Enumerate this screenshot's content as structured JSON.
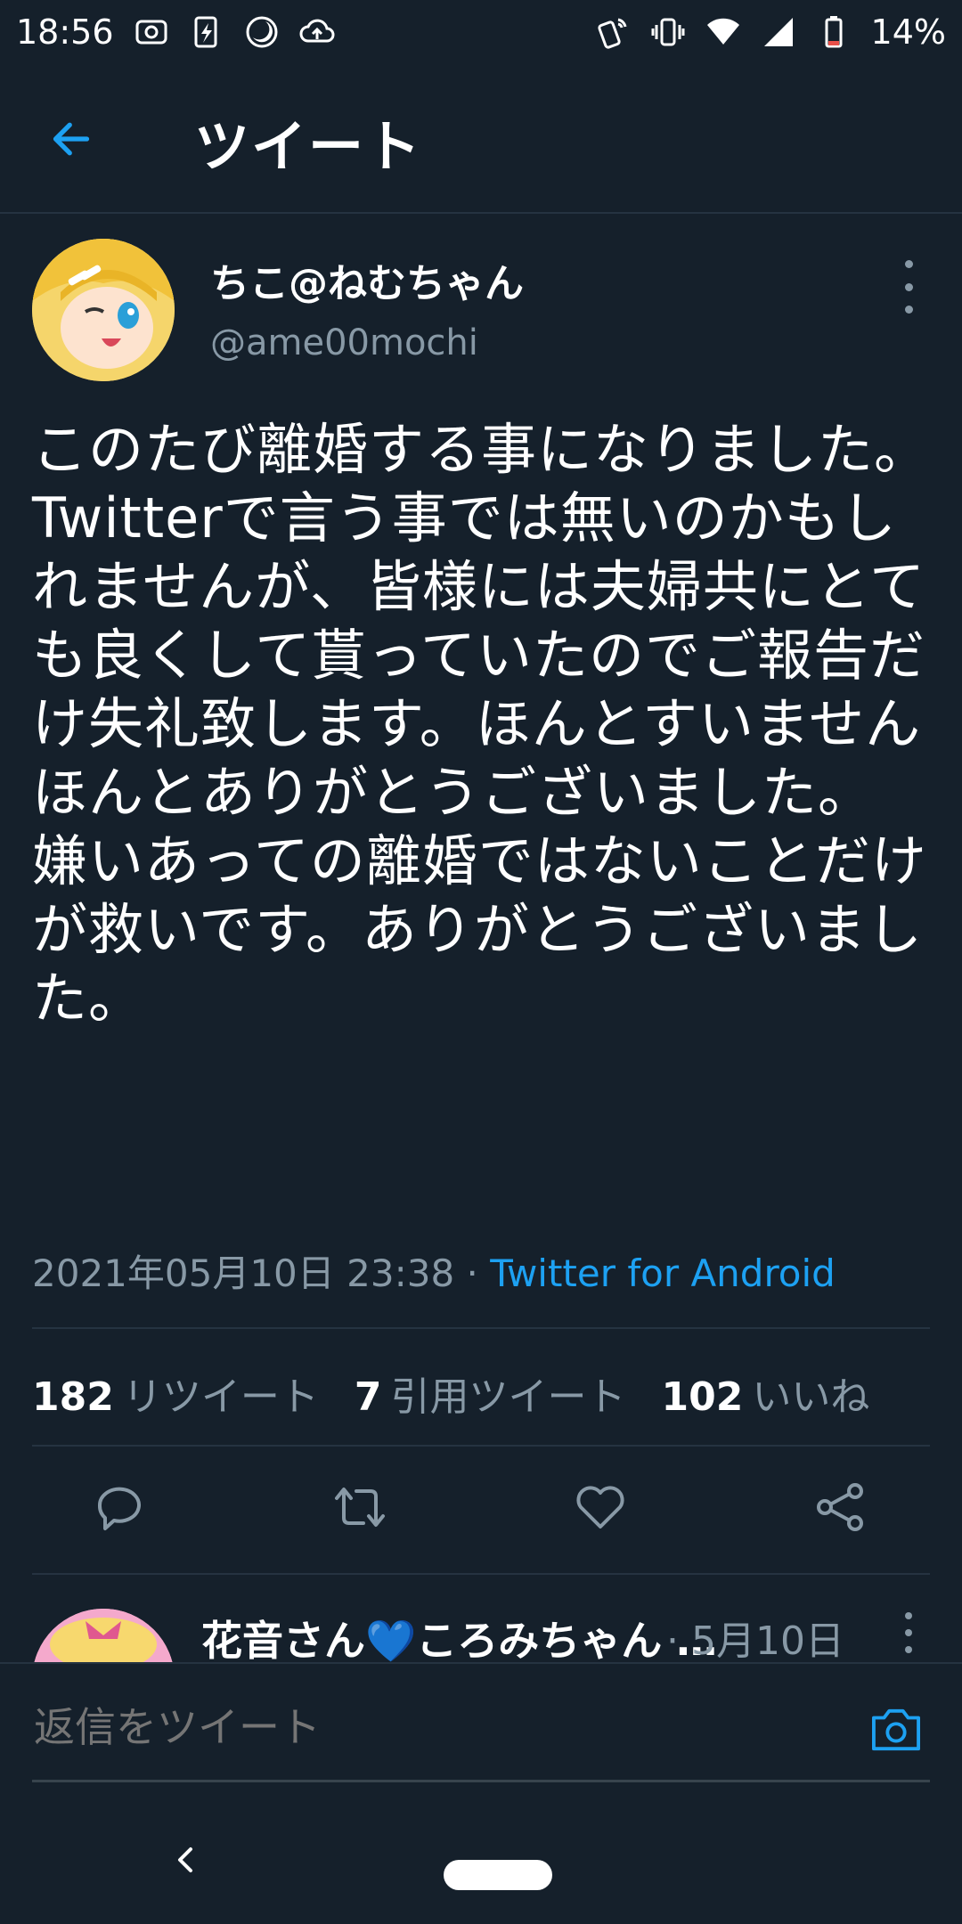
{
  "status_bar": {
    "time": "18:56",
    "battery": "14%",
    "left_icons": [
      "radio-icon",
      "lightning-icon",
      "moon-icon",
      "cloud-upload-icon"
    ],
    "right_icons": [
      "nfc-icon",
      "vibrate-icon",
      "wifi-icon",
      "signal-icon",
      "battery-icon"
    ]
  },
  "header": {
    "title": "ツイート"
  },
  "tweet": {
    "author_name": "ちこ@ねむちゃん",
    "author_handle": "@ame00mochi",
    "text": "このたび離婚する事になりました。\nTwitterで言う事では無いのかもしれませんが、皆様には夫婦共にとても良くして貰っていたのでご報告だけ失礼致します。ほんとすいませんほんとありがとうございました。\n嫌いあっての離婚ではないことだけが救いです。ありがとうございました。",
    "timestamp": "2021年05月10日 23:38",
    "separator": " · ",
    "source": "Twitter for Android",
    "stats": {
      "retweets_count": "182",
      "retweets_label": "リツイート",
      "quotes_count": "7",
      "quotes_label": "引用ツイート",
      "likes_count": "102",
      "likes_label": "いいね"
    }
  },
  "reply_preview": {
    "name": "花音さん",
    "name_heart": "💙",
    "name_rest": "ころみちゃん …",
    "date": "· 5月10日"
  },
  "compose": {
    "placeholder": "返信をツイート"
  },
  "colors": {
    "background": "#15202b",
    "accent": "#1da1f2",
    "muted": "#8899a6",
    "divider": "#253341"
  }
}
